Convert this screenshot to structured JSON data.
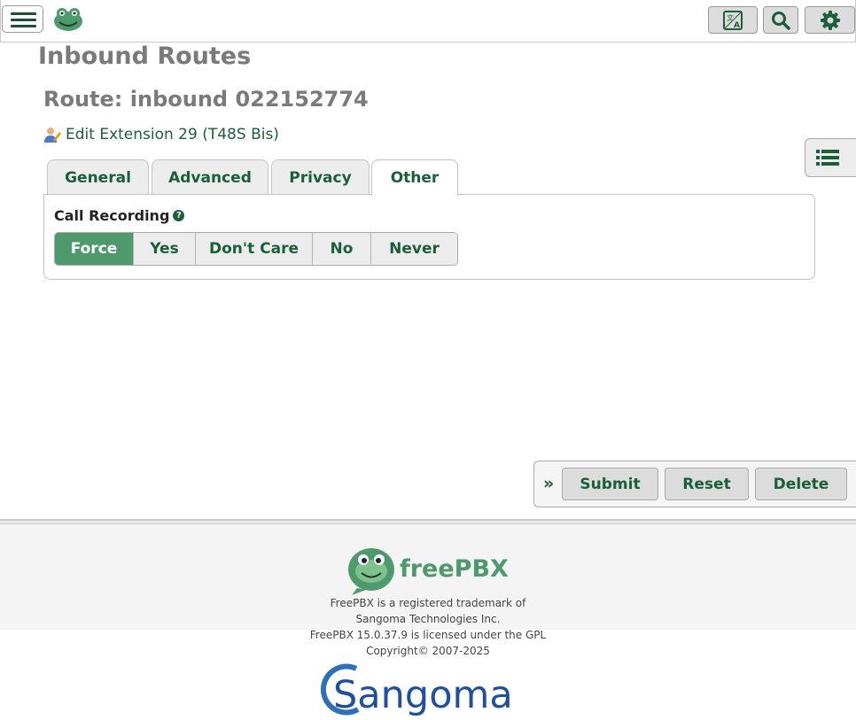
{
  "header": {
    "menu_icon": "hamburger-menu-icon",
    "logo_icon": "freepbx-frog-icon",
    "buttons": [
      {
        "icon": "language-translate-icon"
      },
      {
        "icon": "search-icon"
      },
      {
        "icon": "gear-icon"
      }
    ]
  },
  "page": {
    "title": "Inbound Routes",
    "route_title": "Route: inbound 022152774",
    "edit_link": "Edit Extension 29 (T48S Bis)",
    "edit_icon": "user-edit-icon"
  },
  "tabs": [
    {
      "label": "General",
      "active": false
    },
    {
      "label": "Advanced",
      "active": false
    },
    {
      "label": "Privacy",
      "active": false
    },
    {
      "label": "Other",
      "active": true
    }
  ],
  "call_recording": {
    "label": "Call Recording",
    "help_glyph": "?",
    "options": [
      "Force",
      "Yes",
      "Don't Care",
      "No",
      "Never"
    ],
    "selected": "Force"
  },
  "actions": {
    "expand_glyph": "»",
    "submit": "Submit",
    "reset": "Reset",
    "delete": "Delete"
  },
  "footer": {
    "trademark_line1": "FreePBX is a registered trademark of",
    "trademark_line2": "Sangoma Technologies Inc.",
    "license": "FreePBX 15.0.37.9 is licensed under the GPL",
    "copyright": "Copyright© 2007-2025",
    "freepbx_logo_text": "freePBX",
    "sangoma_logo_text": "Sangoma"
  },
  "colors": {
    "brand_green": "#1b5e3a",
    "selected_green": "#4f9a6c",
    "title_gray": "#7a7a7a"
  }
}
